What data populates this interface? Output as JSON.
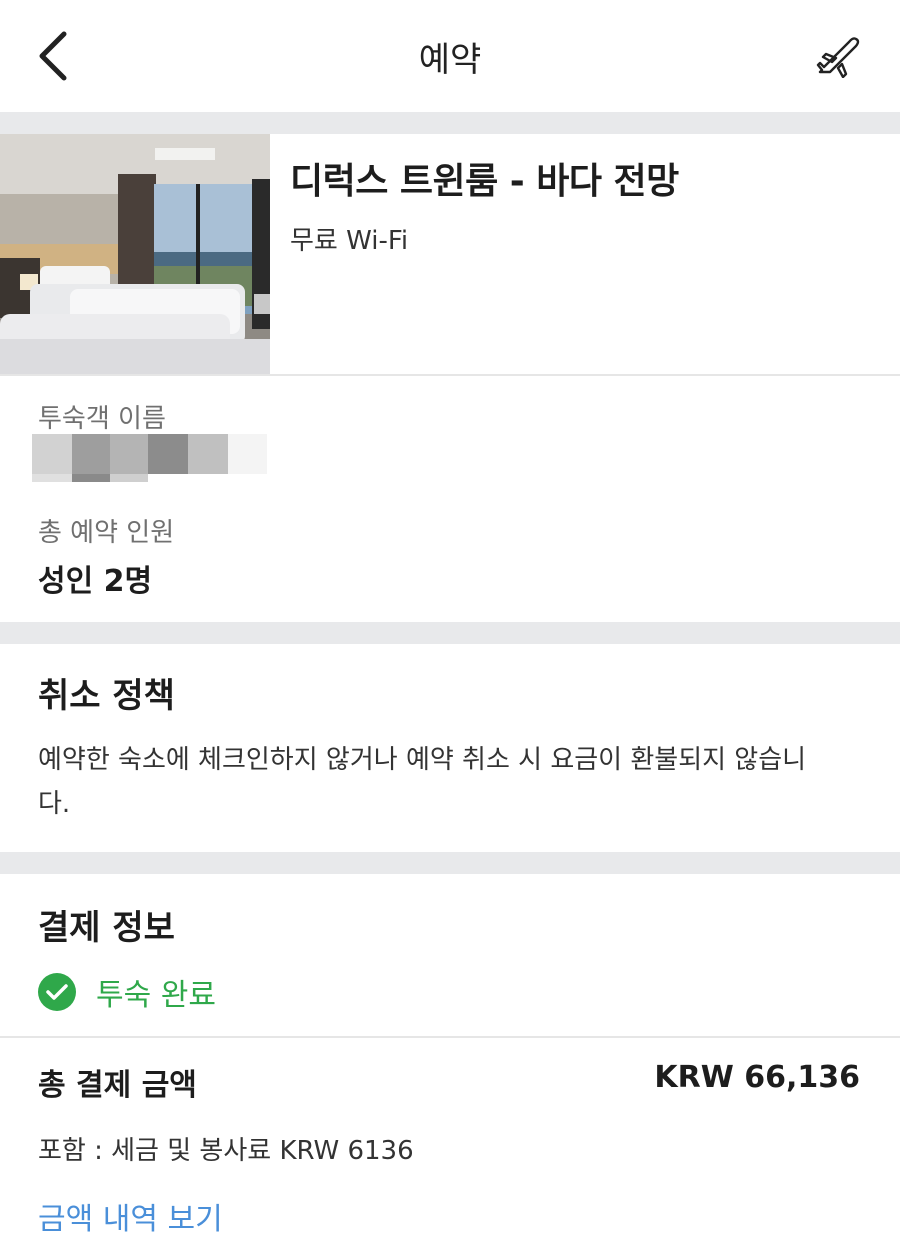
{
  "header": {
    "title": "예약",
    "back_icon": "chevron-left-icon",
    "action_icon": "airplane-icon"
  },
  "room": {
    "name": "디럭스 트윈룸 - 바다 전망",
    "amenity": "무료 Wi-Fi"
  },
  "guest": {
    "name_label": "투숙객 이름",
    "count_label": "총 예약 인원",
    "count_value": "성인 2명"
  },
  "cancellation": {
    "title": "취소 정책",
    "text": "예약한 숙소에 체크인하지 않거나 예약 취소 시 요금이 환불되지 않습니다."
  },
  "payment": {
    "title": "결제 정보",
    "status": "투숙 완료",
    "status_color": "#2fa84a",
    "total_label": "총 결제 금액",
    "total_amount": "KRW 66,136",
    "tax_note": "포함 : 세금 및 봉사료 KRW 6136",
    "details_link": "금액 내역 보기",
    "link_color": "#4a8fd9"
  }
}
